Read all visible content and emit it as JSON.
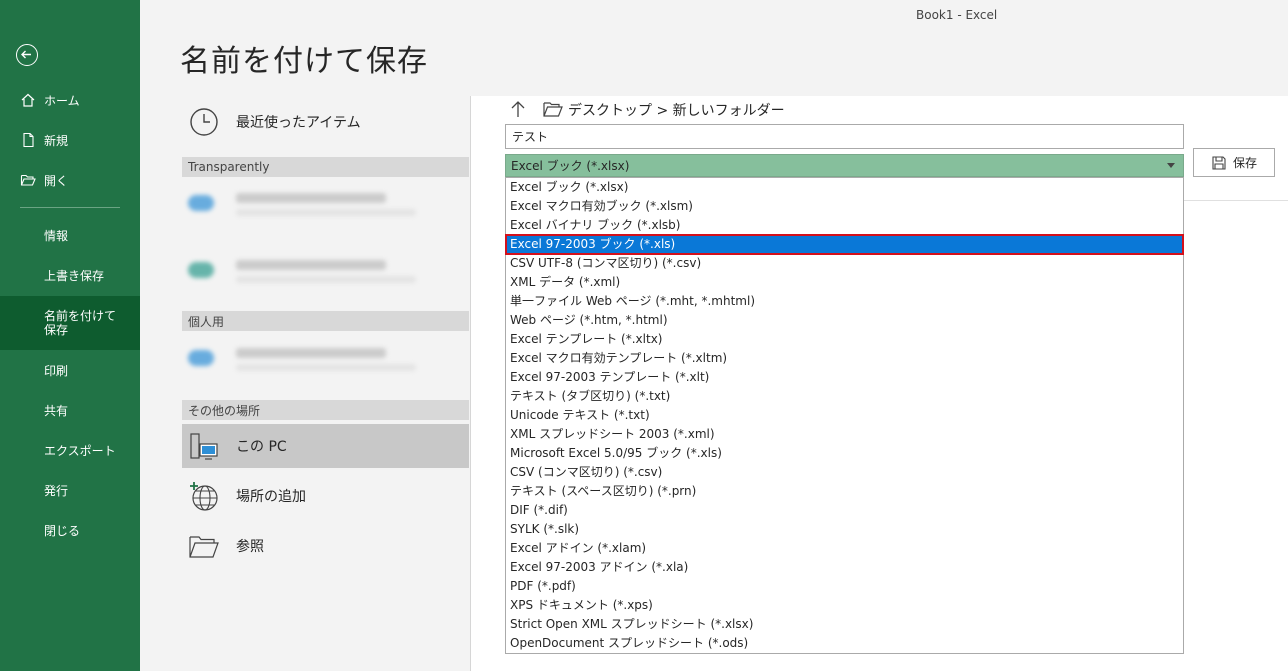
{
  "window_title": "Book1  -  Excel",
  "page_title": "名前を付けて保存",
  "sidebar": {
    "items": [
      {
        "label": "ホーム",
        "icon": "home-icon"
      },
      {
        "label": "新規",
        "icon": "new-document-icon"
      },
      {
        "label": "開く",
        "icon": "open-folder-icon"
      },
      {
        "label": "情報"
      },
      {
        "label": "上書き保存"
      },
      {
        "label": "名前を付けて保存",
        "active": true
      },
      {
        "label": "印刷"
      },
      {
        "label": "共有"
      },
      {
        "label": "エクスポート"
      },
      {
        "label": "発行"
      },
      {
        "label": "閉じる"
      }
    ]
  },
  "locations": {
    "recent": "最近使ったアイテム",
    "section_transparently": "Transparently",
    "section_personal": "個人用",
    "section_other": "その他の場所",
    "this_pc": "この PC",
    "add_place": "場所の追加",
    "browse": "参照"
  },
  "path": {
    "breadcrumb": "デスクトップ > 新しいフォルダー"
  },
  "filename_value": "テスト",
  "file_type": {
    "selected": "Excel ブック (*.xlsx)",
    "options": [
      "Excel ブック (*.xlsx)",
      "Excel マクロ有効ブック (*.xlsm)",
      "Excel バイナリ ブック (*.xlsb)",
      "Excel 97-2003 ブック (*.xls)",
      "CSV UTF-8 (コンマ区切り) (*.csv)",
      "XML データ (*.xml)",
      "単一ファイル Web ページ (*.mht, *.mhtml)",
      "Web ページ (*.htm, *.html)",
      "Excel テンプレート (*.xltx)",
      "Excel マクロ有効テンプレート (*.xltm)",
      "Excel 97-2003 テンプレート (*.xlt)",
      "テキスト (タブ区切り) (*.txt)",
      "Unicode テキスト (*.txt)",
      "XML スプレッドシート 2003 (*.xml)",
      "Microsoft Excel 5.0/95 ブック (*.xls)",
      "CSV (コンマ区切り) (*.csv)",
      "テキスト (スペース区切り) (*.prn)",
      "DIF (*.dif)",
      "SYLK (*.slk)",
      "Excel アドイン (*.xlam)",
      "Excel 97-2003 アドイン (*.xla)",
      "PDF (*.pdf)",
      "XPS ドキュメント (*.xps)",
      "Strict Open XML スプレッドシート (*.xlsx)",
      "OpenDocument スプレッドシート (*.ods)"
    ],
    "highlighted_index": 3
  },
  "save_label": "保存",
  "colors": {
    "sidebar": "#217346",
    "sidebar_active": "#0e5c2f",
    "highlight": "#0a78d7",
    "highlight_border": "#d4101b",
    "select_bg": "#86bf9c"
  }
}
